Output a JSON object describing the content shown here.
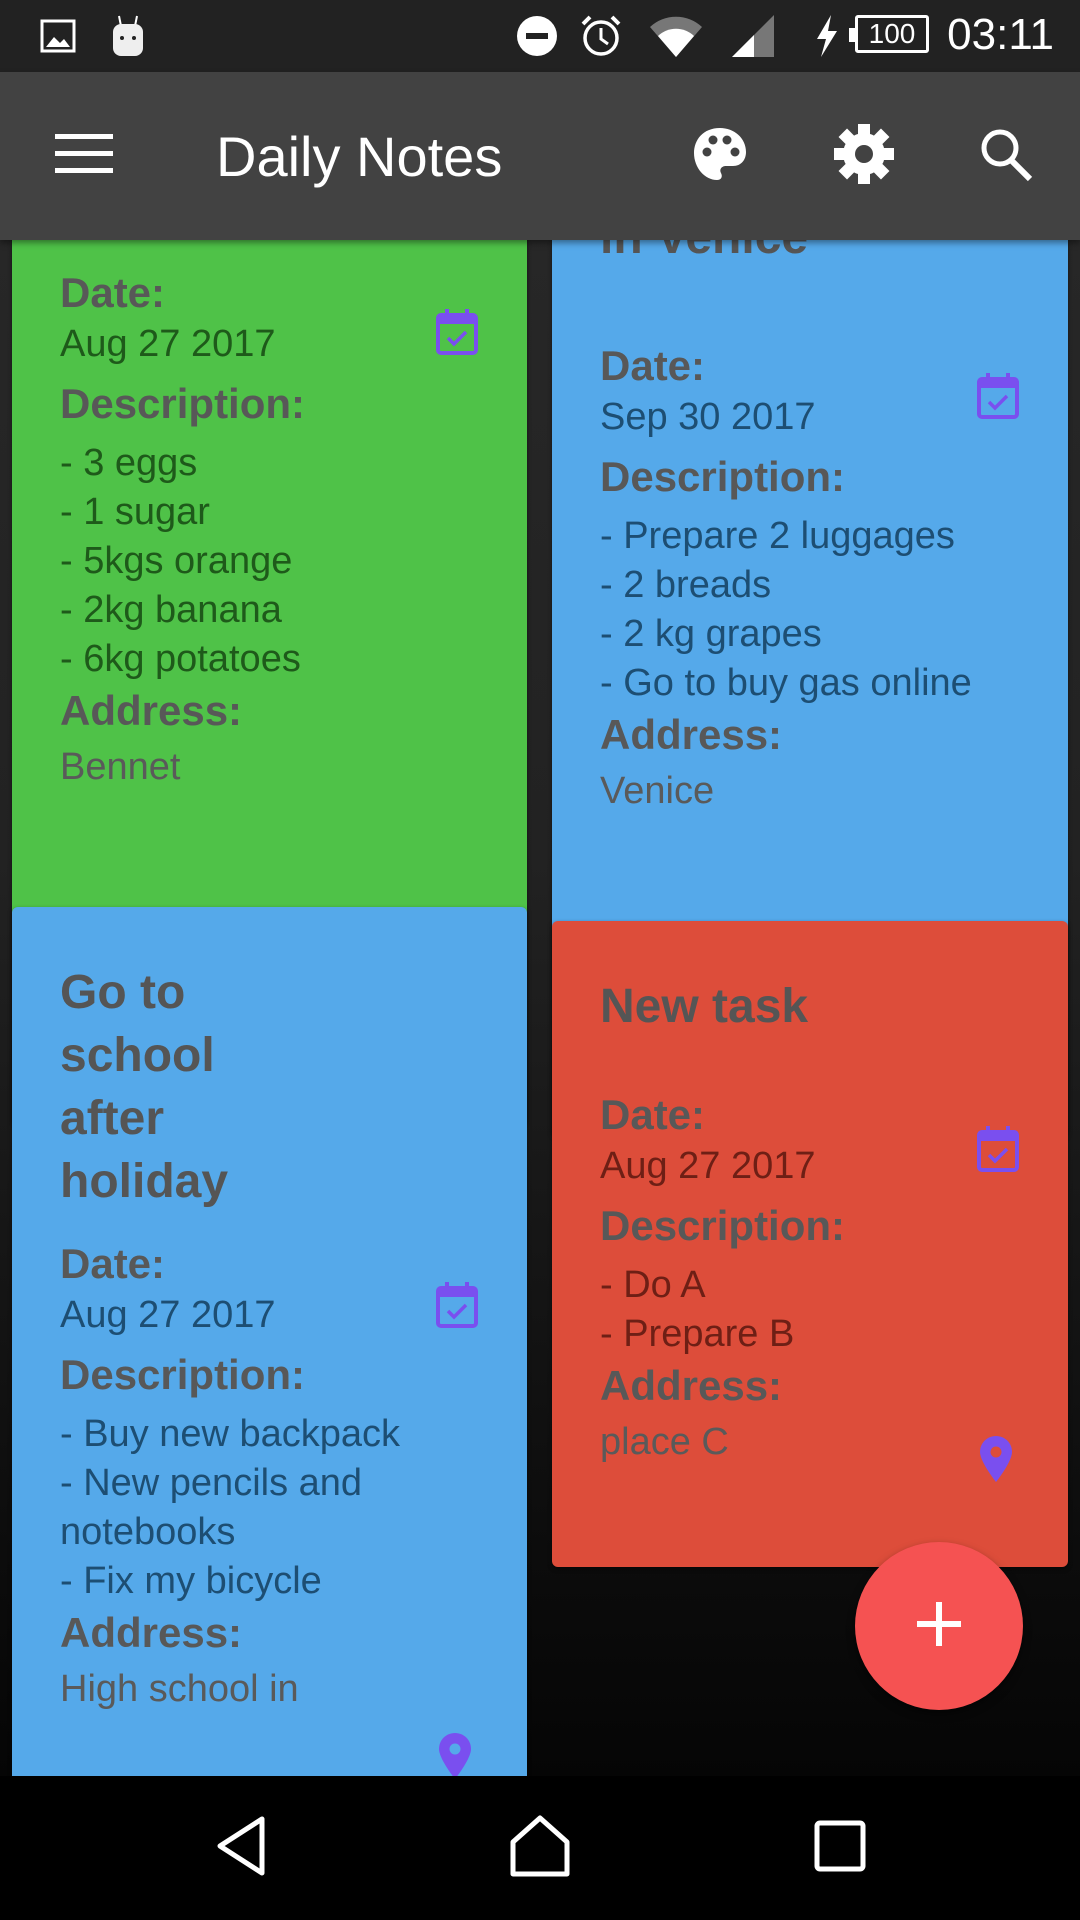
{
  "status_bar": {
    "time": "03:11",
    "battery_level": "100",
    "left_icons": [
      "gallery-notification-icon",
      "android-notification-icon"
    ],
    "right_icons": [
      "do-not-disturb-icon",
      "alarm-icon",
      "wifi-icon",
      "cell-signal-icon",
      "charging-icon",
      "battery-icon"
    ]
  },
  "app_bar": {
    "title": "Daily Notes",
    "actions": [
      "menu-icon",
      "palette-icon",
      "settings-icon",
      "search-icon"
    ]
  },
  "labels": {
    "date": "Date:",
    "description": "Description:",
    "address": "Address:"
  },
  "notes": [
    {
      "color": "#4fc248",
      "title": "",
      "date": "Aug 27 2017",
      "description": [
        "- 3 eggs",
        "- 1 sugar",
        "- 5kgs orange",
        "- 2kg banana",
        "- 6kg potatoes"
      ],
      "address": "Bennet"
    },
    {
      "color": "#55a9ea",
      "title": "in Venice",
      "date": "Sep 30 2017",
      "description": [
        "- Prepare 2 luggages",
        "- 2 breads",
        "- 2 kg grapes",
        "- Go to buy gas online"
      ],
      "address": "Venice"
    },
    {
      "color": "#55a9ea",
      "title": "Go to school after holiday",
      "date": "Aug 27 2017",
      "description": [
        "- Buy new backpack",
        "- New pencils and notebooks",
        "- Fix my bicycle"
      ],
      "address": "High school in"
    },
    {
      "color": "#dd4d3a",
      "title": "New task",
      "date": "Aug 27 2017",
      "description": [
        "- Do A",
        "- Prepare B"
      ],
      "address": "place C"
    }
  ],
  "fab": {
    "label": "+",
    "accent": "#f55252"
  },
  "icon_accent": "#7a4fef",
  "nav_bar": [
    "back",
    "home",
    "recents"
  ]
}
